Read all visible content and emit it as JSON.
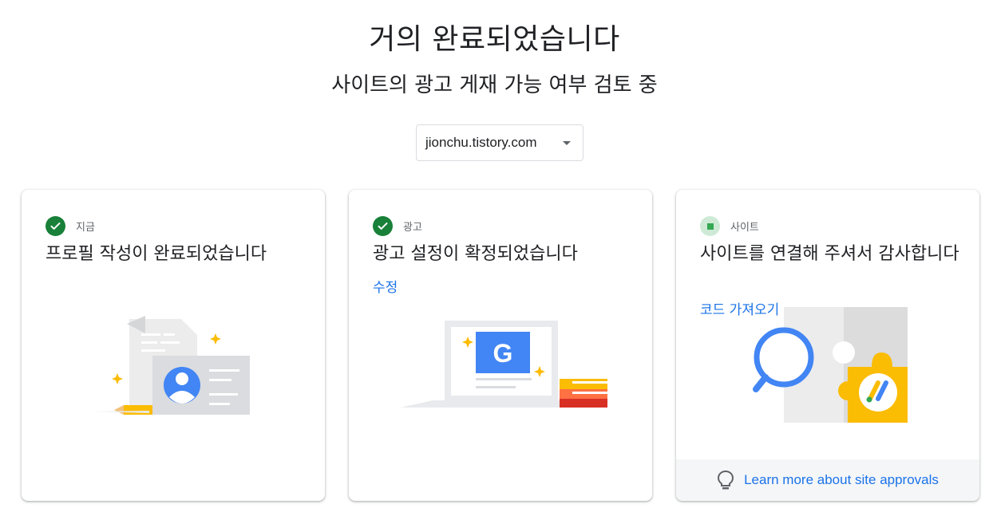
{
  "header": {
    "title": "거의 완료되었습니다",
    "subtitle": "사이트의 광고 게재 가능 여부 검토 중"
  },
  "site_selector": {
    "value": "jionchu.tistory.com"
  },
  "cards": [
    {
      "status": "지금",
      "status_state": "complete",
      "title": "프로필 작성이 완료되었습니다"
    },
    {
      "status": "광고",
      "status_state": "complete",
      "title": "광고 설정이 확정되었습니다",
      "link": "수정"
    },
    {
      "status": "사이트",
      "status_state": "pending",
      "title": "사이트를 연결해 주셔서 감사합니다",
      "link": "코드 가져오기",
      "footer_link": "Learn more about site approvals",
      "footer_icon": "lightbulb-icon"
    }
  ],
  "colors": {
    "accent_blue": "#1a73e8",
    "check_green": "#188038",
    "pending_green": "#34a853",
    "google_yellow": "#fbbc04"
  }
}
